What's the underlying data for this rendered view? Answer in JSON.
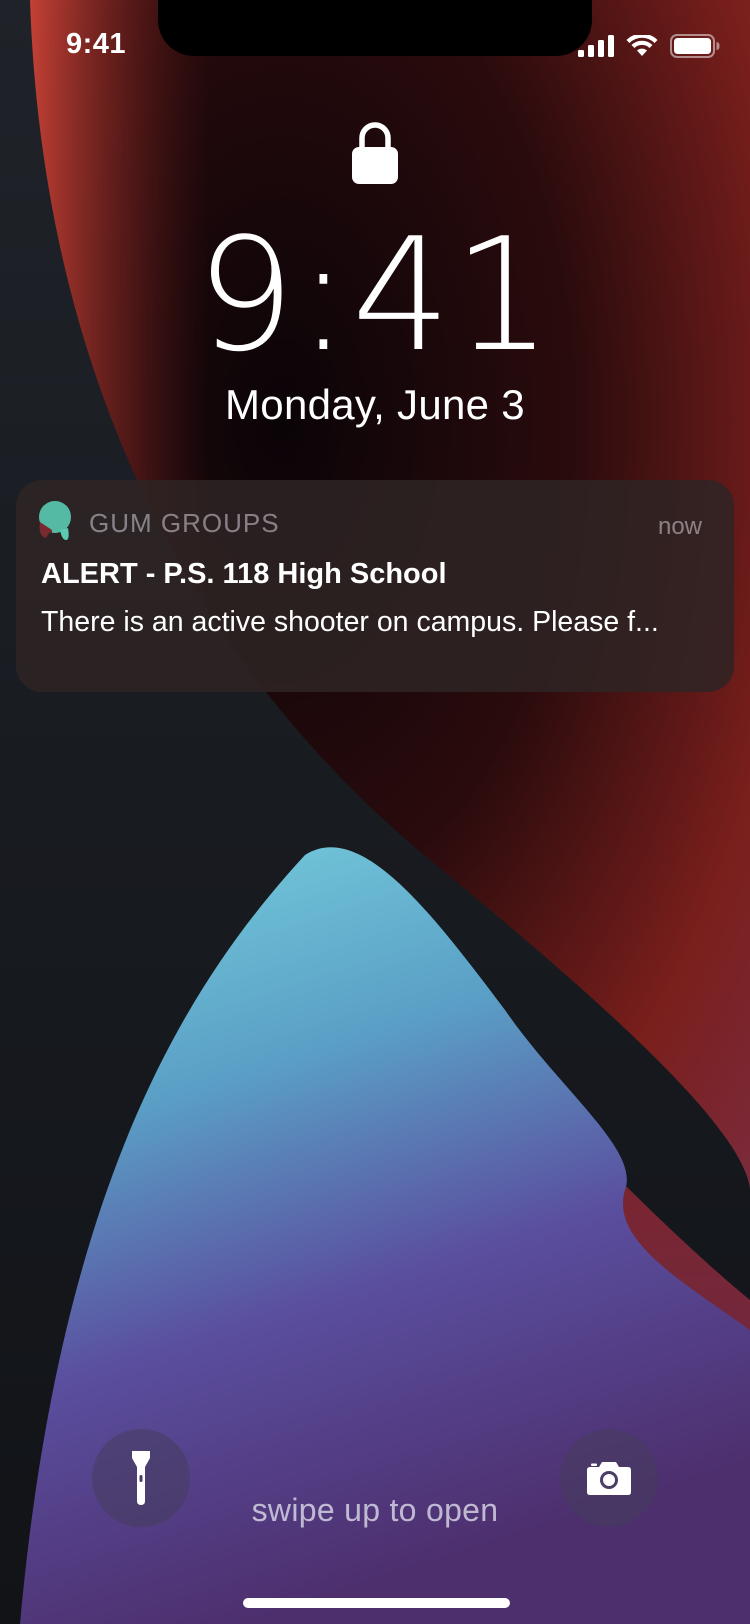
{
  "status_bar": {
    "time": "9:41",
    "icons": [
      "cellular-signal-icon",
      "wifi-icon",
      "battery-icon"
    ]
  },
  "lock_screen": {
    "lock_icon": "lock-icon",
    "time": "9:41",
    "date": "Monday, June 3"
  },
  "notification": {
    "app_icon": "gum-groups-app-icon",
    "app_name": "GUM GROUPS",
    "time": "now",
    "title": "ALERT - P.S. 118 High School",
    "body": "There is an active shooter on campus. Please f..."
  },
  "bottom": {
    "flashlight_icon": "flashlight-icon",
    "camera_icon": "camera-icon",
    "swipe_text": "swipe up to open"
  },
  "colors": {
    "app_icon_teal": "#5cc9b0",
    "wallpaper_red": "#c0392b",
    "wallpaper_blue": "#6fc3d8",
    "wallpaper_purple": "#5b3d8c"
  }
}
